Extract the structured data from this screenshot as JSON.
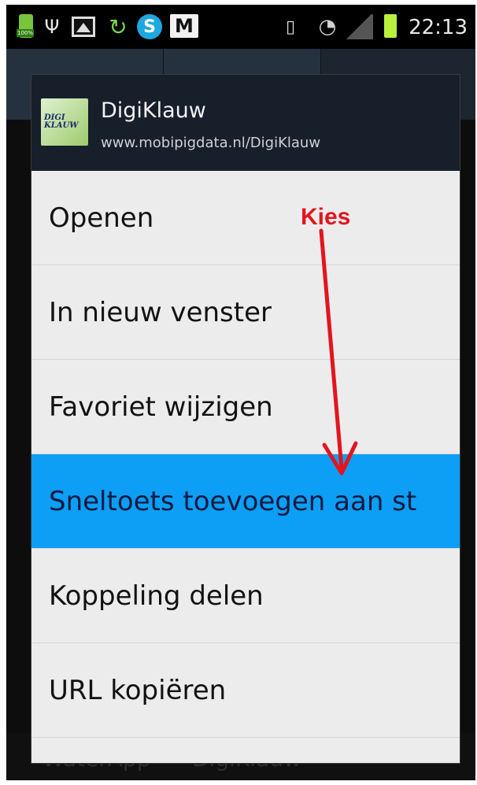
{
  "status_bar": {
    "battery_small_pct": "100%",
    "skype_letter": "S",
    "gmail_letter": "M",
    "time": "22:13",
    "icons": [
      "battery-full-icon",
      "usb-icon",
      "image-icon",
      "sync-icon",
      "skype-icon",
      "gmail-icon",
      "vibrate-icon",
      "wifi-icon",
      "signal-icon",
      "battery-icon"
    ]
  },
  "dialog": {
    "title": "DigiKlauw",
    "subtitle": "www.mobipigdata.nl/DigiKlauw",
    "logo_text": "DIGI KLAUW"
  },
  "menu": {
    "items": [
      {
        "label": "Openen"
      },
      {
        "label": "In nieuw venster"
      },
      {
        "label": "Favoriet wijzigen"
      },
      {
        "label": "Sneltoets toevoegen aan st"
      },
      {
        "label": "Koppeling delen"
      },
      {
        "label": "URL kopiëren"
      }
    ],
    "highlighted_index": 3,
    "highlight_color": "#0d9ef5"
  },
  "annotation": {
    "label": "Kies",
    "color": "#e3141f"
  },
  "background_app": {
    "footer_left": "WaterApp",
    "footer_right": "DigiKlauw"
  }
}
